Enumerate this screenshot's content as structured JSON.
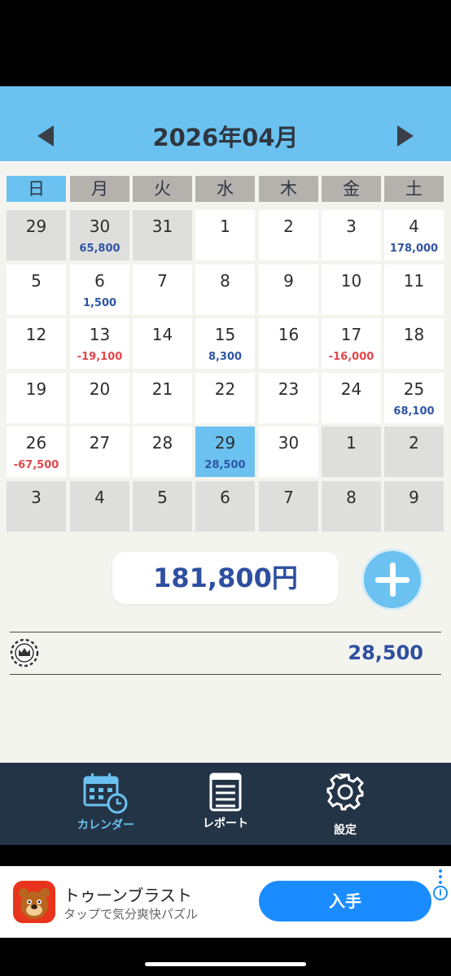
{
  "header": {
    "title": "2026年04月"
  },
  "weekdays": [
    "日",
    "月",
    "火",
    "水",
    "木",
    "金",
    "土"
  ],
  "calendar": {
    "rows": [
      [
        {
          "d": "29",
          "other": true
        },
        {
          "d": "30",
          "other": true,
          "amt": "65,800",
          "type": "pos"
        },
        {
          "d": "31",
          "other": true
        },
        {
          "d": "1"
        },
        {
          "d": "2"
        },
        {
          "d": "3"
        },
        {
          "d": "4",
          "amt": "178,000",
          "type": "pos"
        }
      ],
      [
        {
          "d": "5"
        },
        {
          "d": "6",
          "amt": "1,500",
          "type": "pos"
        },
        {
          "d": "7"
        },
        {
          "d": "8"
        },
        {
          "d": "9"
        },
        {
          "d": "10"
        },
        {
          "d": "11"
        }
      ],
      [
        {
          "d": "12"
        },
        {
          "d": "13",
          "amt": "-19,100",
          "type": "neg"
        },
        {
          "d": "14"
        },
        {
          "d": "15",
          "amt": "8,300",
          "type": "pos"
        },
        {
          "d": "16"
        },
        {
          "d": "17",
          "amt": "-16,000",
          "type": "neg"
        },
        {
          "d": "18"
        }
      ],
      [
        {
          "d": "19"
        },
        {
          "d": "20"
        },
        {
          "d": "21"
        },
        {
          "d": "22"
        },
        {
          "d": "23"
        },
        {
          "d": "24"
        },
        {
          "d": "25",
          "amt": "68,100",
          "type": "pos"
        }
      ],
      [
        {
          "d": "26",
          "amt": "-67,500",
          "type": "neg"
        },
        {
          "d": "27"
        },
        {
          "d": "28"
        },
        {
          "d": "29",
          "today": true,
          "amt": "28,500",
          "type": "pos"
        },
        {
          "d": "30"
        },
        {
          "d": "1",
          "other": true
        },
        {
          "d": "2",
          "other": true
        }
      ],
      [
        {
          "d": "3",
          "other": true
        },
        {
          "d": "4",
          "other": true
        },
        {
          "d": "5",
          "other": true
        },
        {
          "d": "6",
          "other": true
        },
        {
          "d": "7",
          "other": true
        },
        {
          "d": "8",
          "other": true
        },
        {
          "d": "9",
          "other": true
        }
      ]
    ]
  },
  "summary": {
    "total": "181,800円",
    "balance": "28,500"
  },
  "tabs": [
    {
      "label": "カレンダー",
      "icon": "calendar-icon",
      "active": true
    },
    {
      "label": "レポート",
      "icon": "report-icon",
      "active": false
    },
    {
      "label": "設定",
      "icon": "gear-icon",
      "active": false
    }
  ],
  "ad": {
    "title": "トゥーンブラスト",
    "subtitle": "タップで気分爽快パズル",
    "button": "入手",
    "info": "i"
  },
  "colors": {
    "accent": "#6bc2f0",
    "navy": "#243447",
    "positive": "#2f55a4",
    "negative": "#e0474c"
  }
}
